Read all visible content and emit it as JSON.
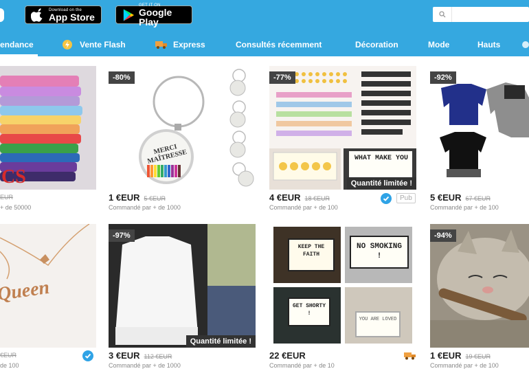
{
  "header": {
    "app_store": {
      "small": "Download on the",
      "big": "App Store"
    },
    "google_play": {
      "small": "GET IT ON",
      "big": "Google Play"
    },
    "search_placeholder": ""
  },
  "nav": [
    {
      "label": "endance",
      "icon": "trending-icon"
    },
    {
      "label": "Vente Flash",
      "icon": "flash-sale-icon"
    },
    {
      "label": "Express",
      "icon": "truck-icon"
    },
    {
      "label": "Consultés récemment",
      "icon": ""
    },
    {
      "label": "Décoration",
      "icon": ""
    },
    {
      "label": "Mode",
      "icon": ""
    },
    {
      "label": "Hauts",
      "icon": ""
    }
  ],
  "products": [
    {
      "badge": "",
      "price": "",
      "old_price": "EUR",
      "sold": "+ de 50000",
      "image_text": "CS",
      "limited": ""
    },
    {
      "badge": "-80%",
      "price": "1 €EUR",
      "old_price": "5 €EUR",
      "sold": "Commandé par + de 1000",
      "image_text": "MERCI MAÎTRESSE",
      "limited": ""
    },
    {
      "badge": "-77%",
      "price": "4 €EUR",
      "old_price": "18 €EUR",
      "sold": "Commandé par + de 100",
      "image_text": "WHAT MAKE YOU",
      "limited": "Quantité limitée !",
      "pub": "Pub"
    },
    {
      "badge": "-92%",
      "price": "5 €EUR",
      "old_price": "67 €EUR",
      "sold": "Commandé par + de 100",
      "image_text": "",
      "limited": ""
    },
    {
      "badge": "",
      "price": "",
      "old_price": "€EUR",
      "sold": "de 100",
      "image_text": "Queen",
      "limited": ""
    },
    {
      "badge": "-97%",
      "price": "3 €EUR",
      "old_price": "112 €EUR",
      "sold": "Commandé par + de 1000",
      "image_text": "",
      "limited": "Quantité limitée !"
    },
    {
      "badge": "",
      "price": "22 €EUR",
      "old_price": "",
      "sold": "Commandé par + de 10",
      "image_text": "",
      "limited": "",
      "lightbox": [
        "KEEP THE FAITH",
        "NO SMOKING !",
        "GET SHORTY !",
        "YOU ARE LOVED"
      ]
    },
    {
      "badge": "-94%",
      "price": "1 €EUR",
      "old_price": "19 €EUR",
      "sold": "Commandé par + de 100",
      "image_text": "",
      "limited": ""
    }
  ],
  "colors": {
    "header": "#35a8e0",
    "badge": "#444444",
    "verified": "#2fa3e6",
    "truck": "#f0a040"
  }
}
